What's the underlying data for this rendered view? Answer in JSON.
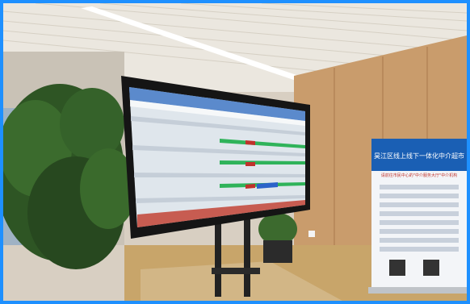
{
  "scene": {
    "description_free": true,
    "colors": {
      "border": "#1e90ff",
      "ceiling": "#e8e4dc",
      "wood_wall": "#c89a6a",
      "floor": "#c9a66a",
      "tv_bezel": "#1a1a1a",
      "screen_bg": "#dfe6ec",
      "green_bar": "#2fb35a",
      "red_cell": "#c0322b",
      "blue_cell": "#2b63c9",
      "plant": "#2f5a25",
      "banner_blue": "#1a5fb4",
      "banner_bg": "#f3f5f8"
    },
    "banner": {
      "header_text": "昊江区线上线下一体化中介超市",
      "subtitle_text": "请前往市民中心的\"中介服务大厅\"中介机构"
    }
  }
}
